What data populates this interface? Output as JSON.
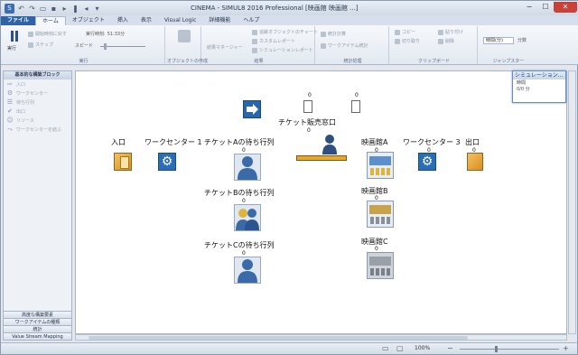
{
  "window": {
    "title": "CINEMA - SIMUL8 2016 Professional [映画館 映画館 ...]"
  },
  "tabs": [
    "ファイル",
    "ホーム",
    "オブジェクト",
    "挿入",
    "表示",
    "Visual Logic",
    "詳細機能",
    "ヘルプ"
  ],
  "ribbon": {
    "run": {
      "label": "実行",
      "reset": "開始時刻に戻す",
      "step": "ステップ",
      "speed": "スピード",
      "time_label": "実行時刻:",
      "time_value": "51:33分"
    },
    "build": {
      "label": "オブジェクトの作成"
    },
    "report": {
      "label": "結果",
      "items": [
        "結果マネージャー",
        "追跡オブジェクトのチャート",
        "カスタムレポート",
        "シミュレーションレポート"
      ]
    },
    "stat": {
      "label": "統計処理",
      "items": [
        "統計計算",
        "ワークアイテム統計"
      ]
    },
    "clip": {
      "label": "クリップボード",
      "items": [
        "コピー",
        "切り取り",
        "貼り付け",
        "削除"
      ]
    },
    "jump": {
      "label": "ジャンプスター",
      "input": "時間(分)",
      "unit": "分数"
    }
  },
  "left_panel": {
    "header": "基本的な構築ブロック",
    "items": [
      "入口",
      "ワークセンター",
      "待ち行列",
      "出口",
      "リソース",
      "ワークセンターを結ぶ"
    ],
    "tabs": [
      "高度な構築要素",
      "ワークアイテムの種類",
      "統計",
      "Value Stream Mapping"
    ]
  },
  "canvas": {
    "ticket_counter": {
      "label": "チケット販売窓口",
      "count": "0"
    },
    "entry": {
      "label": "入口"
    },
    "workcenter1": {
      "label": "ワークセンター 1"
    },
    "queueA": {
      "label": "チケットAの待ち行列",
      "count": "0"
    },
    "queueB": {
      "label": "チケットBの待ち行列",
      "count": "0"
    },
    "queueC": {
      "label": "チケットCの待ち行列",
      "count": "0"
    },
    "theaterA": {
      "label": "映画館A",
      "count": "0"
    },
    "theaterB": {
      "label": "映画館B",
      "count": "0"
    },
    "theaterC": {
      "label": "映画館C",
      "count": "0"
    },
    "workcenter3": {
      "label": "ワークセンター 3",
      "count": "0"
    },
    "exit": {
      "label": "出口",
      "count": "0"
    },
    "ticket_doc_counts": [
      "0",
      "0"
    ]
  },
  "mini": {
    "title": "シミュレーション...",
    "lines": [
      "時間",
      "0/0 分"
    ]
  },
  "status": {
    "zoom": "100%"
  }
}
